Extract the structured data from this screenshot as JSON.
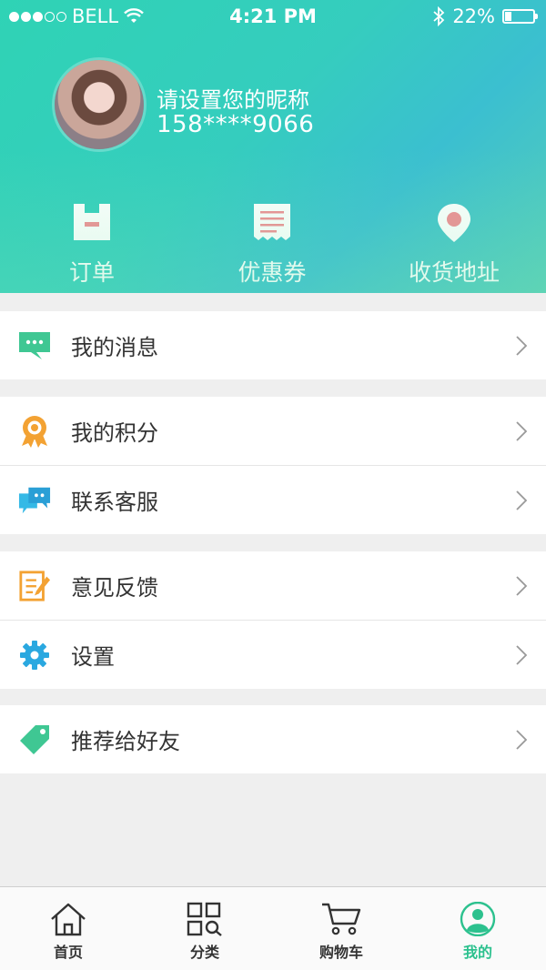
{
  "status_bar": {
    "carrier": "BELL",
    "time": "4:21 PM",
    "battery": "22%",
    "battery_level": 0.22
  },
  "profile": {
    "nickname": "请设置您的昵称",
    "phone": "158****9066"
  },
  "quick_links": [
    {
      "label": "订单",
      "icon": "order-icon"
    },
    {
      "label": "优惠券",
      "icon": "coupon-icon"
    },
    {
      "label": "收货地址",
      "icon": "location-pin-icon"
    }
  ],
  "menu": {
    "messages": "我的消息",
    "points": "我的积分",
    "service": "联系客服",
    "feedback": "意见反馈",
    "settings": "设置",
    "recommend": "推荐给好友"
  },
  "tabs": [
    {
      "label": "首页",
      "icon": "home-icon"
    },
    {
      "label": "分类",
      "icon": "category-icon"
    },
    {
      "label": "购物车",
      "icon": "cart-icon"
    },
    {
      "label": "我的",
      "icon": "profile-icon",
      "active": true
    }
  ],
  "colors": {
    "accent": "#2cc18e",
    "header_start": "#2fd3b5",
    "header_end": "#3bbfd0"
  }
}
